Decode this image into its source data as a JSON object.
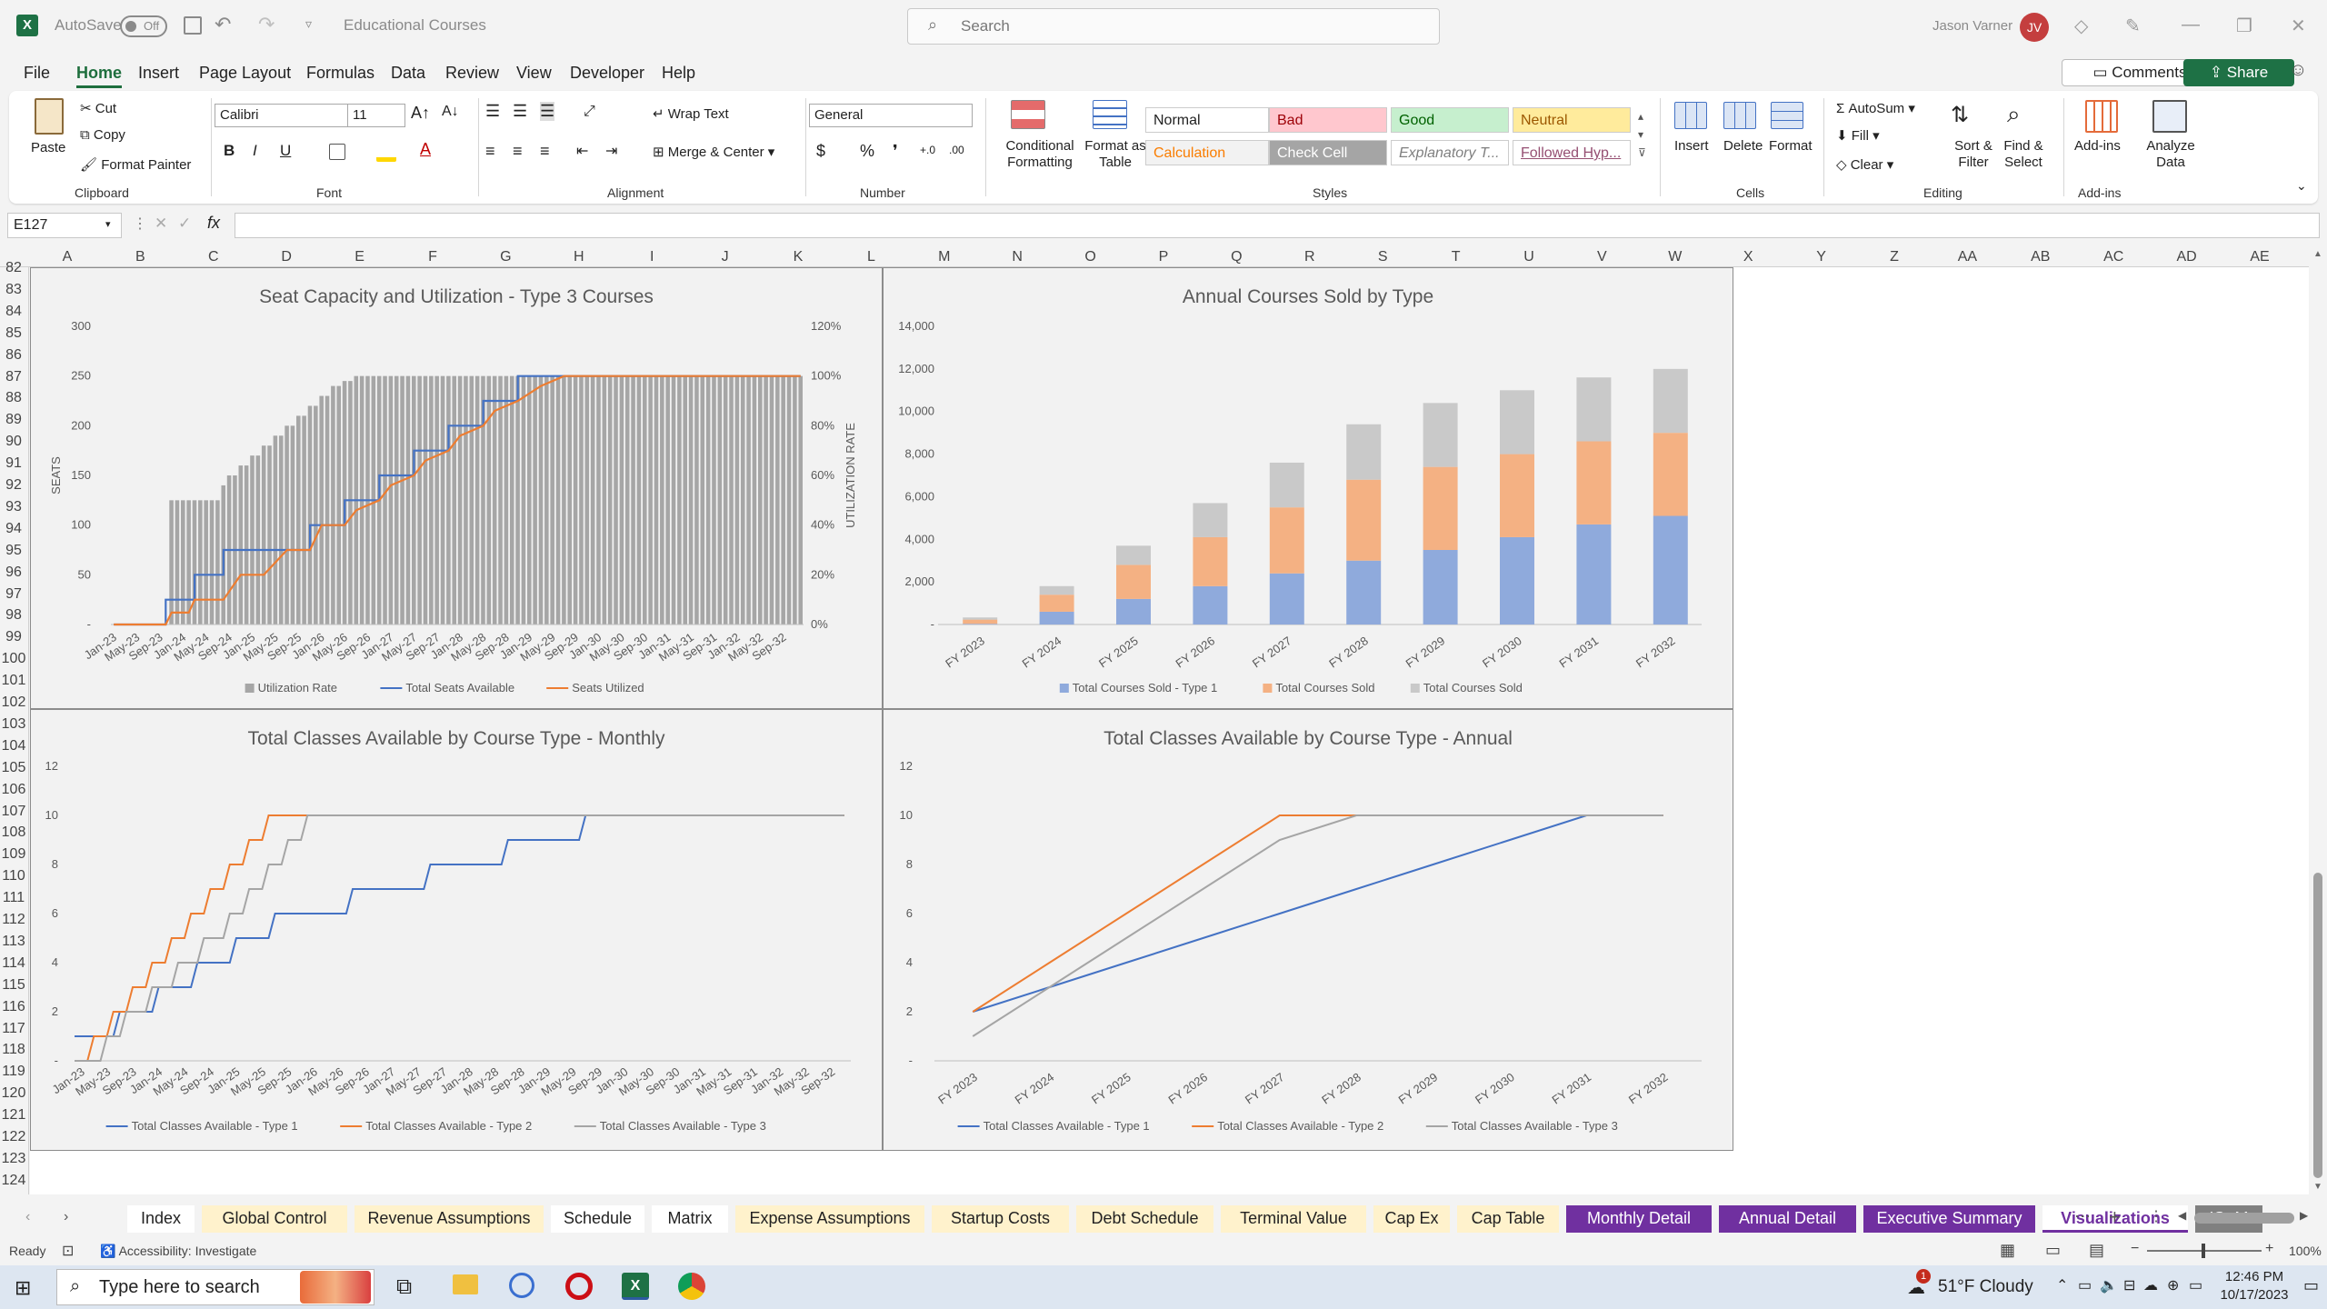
{
  "titlebar": {
    "autosave": "AutoSave",
    "autosave_state": "Off",
    "filename": "Educational Courses",
    "search_placeholder": "Search",
    "user": "Jason Varner",
    "initials": "JV"
  },
  "menu": [
    "File",
    "Home",
    "Insert",
    "Page Layout",
    "Formulas",
    "Data",
    "Review",
    "View",
    "Developer",
    "Help"
  ],
  "menu_active": "Home",
  "actions": {
    "comments": "Comments",
    "share": "Share"
  },
  "ribbon": {
    "clipboard": {
      "paste": "Paste",
      "cut": "Cut",
      "copy": "Copy",
      "format_painter": "Format Painter",
      "label": "Clipboard"
    },
    "font": {
      "name": "Calibri",
      "size": "11",
      "label": "Font",
      "bold": "B",
      "italic": "I",
      "underline": "U"
    },
    "alignment": {
      "wrap": "Wrap Text",
      "merge": "Merge & Center",
      "label": "Alignment"
    },
    "number": {
      "format": "General",
      "label": "Number",
      "currency": "$",
      "percent": "%"
    },
    "styles": {
      "conditional": "Conditional Formatting",
      "format_table": "Format as Table",
      "label": "Styles",
      "cells": [
        {
          "name": "Normal",
          "bg": "#ffffff",
          "fg": "#222222"
        },
        {
          "name": "Bad",
          "bg": "#ffc7ce",
          "fg": "#9c0006"
        },
        {
          "name": "Good",
          "bg": "#c6efce",
          "fg": "#006100"
        },
        {
          "name": "Neutral",
          "bg": "#ffeb9c",
          "fg": "#9c5700"
        },
        {
          "name": "Calculation",
          "bg": "#f2f2f2",
          "fg": "#fa7d00"
        },
        {
          "name": "Check Cell",
          "bg": "#a5a5a5",
          "fg": "#ffffff"
        },
        {
          "name": "Explanatory T...",
          "bg": "#ffffff",
          "fg": "#7f7f7f"
        },
        {
          "name": "Followed Hyp...",
          "bg": "#ffffff",
          "fg": "#954f72"
        }
      ]
    },
    "cells": {
      "insert": "Insert",
      "delete": "Delete",
      "format": "Format",
      "label": "Cells"
    },
    "editing": {
      "autosum": "AutoSum",
      "fill": "Fill",
      "clear": "Clear",
      "sort": "Sort & Filter",
      "find": "Find & Select",
      "label": "Editing"
    },
    "addins": {
      "addins": "Add-ins",
      "analyze": "Analyze Data",
      "label": "Add-ins"
    }
  },
  "formula": {
    "namebox": "E127",
    "fx": "fx",
    "value": ""
  },
  "columns": [
    "A",
    "B",
    "C",
    "D",
    "E",
    "F",
    "G",
    "H",
    "I",
    "J",
    "K",
    "L",
    "M",
    "N",
    "O",
    "P",
    "Q",
    "R",
    "S",
    "T",
    "U",
    "V",
    "W",
    "X",
    "Y",
    "Z",
    "AA",
    "AB",
    "AC",
    "AD",
    "AE"
  ],
  "rows": [
    "82",
    "83",
    "84",
    "85",
    "86",
    "87",
    "88",
    "89",
    "90",
    "91",
    "92",
    "93",
    "94",
    "95",
    "96",
    "97",
    "98",
    "99",
    "100",
    "101",
    "102",
    "103",
    "104",
    "105",
    "106",
    "107",
    "108",
    "109",
    "110",
    "111",
    "112",
    "113",
    "114",
    "115",
    "116",
    "117",
    "118",
    "119",
    "120",
    "121",
    "122",
    "123",
    "124"
  ],
  "chart_data": [
    {
      "type": "bar",
      "title": "Seat Capacity and Utilization - Type 3 Courses",
      "ylabel": "SEATS",
      "y2label": "UTILIZATION RATE",
      "ylim": [
        0,
        300
      ],
      "y2lim": [
        0,
        1.2
      ],
      "yticks": [
        "300",
        "250",
        "200",
        "150",
        "100",
        "50",
        "-"
      ],
      "y2ticks": [
        "120%",
        "100%",
        "80%",
        "60%",
        "40%",
        "20%",
        "0%"
      ],
      "xticks": [
        "Jan-23",
        "May-23",
        "Sep-23",
        "Jan-24",
        "May-24",
        "Sep-24",
        "Jan-25",
        "May-25",
        "Sep-25",
        "Jan-26",
        "May-26",
        "Sep-26",
        "Jan-27",
        "May-27",
        "Sep-27",
        "Jan-28",
        "May-28",
        "Sep-28",
        "Jan-29",
        "May-29",
        "Sep-29",
        "Jan-30",
        "May-30",
        "Sep-30",
        "Jan-31",
        "May-31",
        "Sep-31",
        "Jan-32",
        "May-32",
        "Sep-32"
      ],
      "series": [
        {
          "name": "Utilization Rate",
          "kind": "bar",
          "color": "#a6a6a6",
          "step_points": [
            [
              0,
              0
            ],
            [
              9,
              0
            ],
            [
              10,
              0.5
            ],
            [
              18,
              0.5
            ],
            [
              19,
              0.56
            ],
            [
              20,
              0.6
            ],
            [
              22,
              0.64
            ],
            [
              24,
              0.68
            ],
            [
              26,
              0.72
            ],
            [
              28,
              0.76
            ],
            [
              30,
              0.8
            ],
            [
              32,
              0.84
            ],
            [
              34,
              0.88
            ],
            [
              36,
              0.92
            ],
            [
              38,
              0.96
            ],
            [
              40,
              0.98
            ],
            [
              42,
              1.0
            ],
            [
              119,
              1.0
            ]
          ]
        },
        {
          "name": "Total Seats Available",
          "kind": "line",
          "color": "#4472c4",
          "step_points": [
            [
              0,
              0
            ],
            [
              9,
              0
            ],
            [
              9,
              25
            ],
            [
              14,
              25
            ],
            [
              14,
              50
            ],
            [
              19,
              50
            ],
            [
              19,
              75
            ],
            [
              34,
              75
            ],
            [
              34,
              100
            ],
            [
              40,
              100
            ],
            [
              40,
              125
            ],
            [
              46,
              125
            ],
            [
              46,
              150
            ],
            [
              52,
              150
            ],
            [
              52,
              175
            ],
            [
              58,
              175
            ],
            [
              58,
              200
            ],
            [
              64,
              200
            ],
            [
              64,
              225
            ],
            [
              70,
              225
            ],
            [
              70,
              250
            ],
            [
              119,
              250
            ]
          ]
        },
        {
          "name": "Seats Utilized",
          "kind": "line",
          "color": "#ed7d31",
          "points": [
            [
              0,
              0
            ],
            [
              9,
              0
            ],
            [
              10,
              12
            ],
            [
              13,
              12
            ],
            [
              14,
              25
            ],
            [
              19,
              25
            ],
            [
              22,
              50
            ],
            [
              26,
              50
            ],
            [
              30,
              75
            ],
            [
              34,
              75
            ],
            [
              36,
              100
            ],
            [
              40,
              100
            ],
            [
              42,
              115
            ],
            [
              46,
              125
            ],
            [
              48,
              140
            ],
            [
              52,
              150
            ],
            [
              54,
              165
            ],
            [
              58,
              175
            ],
            [
              60,
              190
            ],
            [
              64,
              200
            ],
            [
              66,
              215
            ],
            [
              70,
              225
            ],
            [
              74,
              240
            ],
            [
              78,
              250
            ],
            [
              119,
              250
            ]
          ]
        }
      ],
      "x_count": 120,
      "legend": "bottom"
    },
    {
      "type": "bar",
      "title": "Annual Courses Sold by Type",
      "categories": [
        "FY 2023",
        "FY 2024",
        "FY 2025",
        "FY 2026",
        "FY 2027",
        "FY 2028",
        "FY 2029",
        "FY 2030",
        "FY 2031",
        "FY 2032"
      ],
      "ylim": [
        0,
        14000
      ],
      "yticks": [
        "14,000",
        "12,000",
        "10,000",
        "8,000",
        "6,000",
        "4,000",
        "2,000",
        "-"
      ],
      "series": [
        {
          "name": "Total Courses Sold - Type 1",
          "color": "#8faadc",
          "values": [
            30,
            600,
            1200,
            1800,
            2400,
            3000,
            3500,
            4100,
            4700,
            5100
          ]
        },
        {
          "name": "Total Courses Sold",
          "color": "#f4b183",
          "values": [
            200,
            800,
            1600,
            2300,
            3100,
            3800,
            3900,
            3900,
            3900,
            3900
          ]
        },
        {
          "name": "Total Courses Sold",
          "color": "#c9c9c9",
          "values": [
            100,
            400,
            900,
            1600,
            2100,
            2600,
            3000,
            3000,
            3000,
            3000
          ]
        }
      ],
      "legend": "bottom"
    },
    {
      "type": "line",
      "title": "Total Classes Available by Course Type - Monthly",
      "ylim": [
        0,
        12
      ],
      "yticks": [
        "12",
        "10",
        "8",
        "6",
        "4",
        "2",
        "-"
      ],
      "xticks": [
        "Jan-23",
        "May-23",
        "Sep-23",
        "Jan-24",
        "May-24",
        "Sep-24",
        "Jan-25",
        "May-25",
        "Sep-25",
        "Jan-26",
        "May-26",
        "Sep-26",
        "Jan-27",
        "May-27",
        "Sep-27",
        "Jan-28",
        "May-28",
        "Sep-28",
        "Jan-29",
        "May-29",
        "Sep-29",
        "Jan-30",
        "May-30",
        "Sep-30",
        "Jan-31",
        "May-31",
        "Sep-31",
        "Jan-32",
        "May-32",
        "Sep-32"
      ],
      "x_count": 120,
      "series": [
        {
          "name": "Total Classes Available - Type 1",
          "color": "#4472c4",
          "points": [
            [
              0,
              1
            ],
            [
              6,
              1
            ],
            [
              7,
              2
            ],
            [
              12,
              2
            ],
            [
              13,
              3
            ],
            [
              18,
              3
            ],
            [
              19,
              4
            ],
            [
              24,
              4
            ],
            [
              25,
              5
            ],
            [
              30,
              5
            ],
            [
              31,
              6
            ],
            [
              42,
              6
            ],
            [
              43,
              7
            ],
            [
              54,
              7
            ],
            [
              55,
              8
            ],
            [
              66,
              8
            ],
            [
              67,
              9
            ],
            [
              78,
              9
            ],
            [
              79,
              10
            ],
            [
              119,
              10
            ]
          ]
        },
        {
          "name": "Total Classes Available - Type 2",
          "color": "#ed7d31",
          "points": [
            [
              0,
              0
            ],
            [
              2,
              0
            ],
            [
              3,
              1
            ],
            [
              5,
              1
            ],
            [
              6,
              2
            ],
            [
              8,
              2
            ],
            [
              9,
              3
            ],
            [
              11,
              3
            ],
            [
              12,
              4
            ],
            [
              14,
              4
            ],
            [
              15,
              5
            ],
            [
              17,
              5
            ],
            [
              18,
              6
            ],
            [
              20,
              6
            ],
            [
              21,
              7
            ],
            [
              23,
              7
            ],
            [
              24,
              8
            ],
            [
              26,
              8
            ],
            [
              27,
              9
            ],
            [
              29,
              9
            ],
            [
              30,
              10
            ],
            [
              119,
              10
            ]
          ]
        },
        {
          "name": "Total Classes Available - Type 3",
          "color": "#a5a5a5",
          "points": [
            [
              0,
              0
            ],
            [
              4,
              0
            ],
            [
              5,
              1
            ],
            [
              7,
              1
            ],
            [
              8,
              2
            ],
            [
              11,
              2
            ],
            [
              12,
              3
            ],
            [
              15,
              3
            ],
            [
              16,
              4
            ],
            [
              19,
              4
            ],
            [
              20,
              5
            ],
            [
              23,
              5
            ],
            [
              24,
              6
            ],
            [
              26,
              6
            ],
            [
              27,
              7
            ],
            [
              29,
              7
            ],
            [
              30,
              8
            ],
            [
              32,
              8
            ],
            [
              33,
              9
            ],
            [
              35,
              9
            ],
            [
              36,
              10
            ],
            [
              119,
              10
            ]
          ]
        }
      ],
      "legend": "bottom"
    },
    {
      "type": "line",
      "title": "Total Classes Available by Course Type - Annual",
      "ylim": [
        0,
        12
      ],
      "yticks": [
        "12",
        "10",
        "8",
        "6",
        "4",
        "2",
        "-"
      ],
      "categories": [
        "FY 2023",
        "FY 2024",
        "FY 2025",
        "FY 2026",
        "FY 2027",
        "FY 2028",
        "FY 2029",
        "FY 2030",
        "FY 2031",
        "FY 2032"
      ],
      "series": [
        {
          "name": "Total Classes Available - Type 1",
          "color": "#4472c4",
          "values": [
            2,
            3,
            4,
            5,
            6,
            7,
            8,
            9,
            10,
            10
          ]
        },
        {
          "name": "Total Classes Available - Type 2",
          "color": "#ed7d31",
          "values": [
            2,
            4,
            6,
            8,
            10,
            10,
            10,
            10,
            10,
            10
          ]
        },
        {
          "name": "Total Classes Available - Type 3",
          "color": "#a5a5a5",
          "values": [
            1,
            3,
            5,
            7,
            9,
            10,
            10,
            10,
            10,
            10
          ]
        }
      ],
      "legend": "bottom"
    }
  ],
  "tabs": [
    {
      "label": "Index",
      "style": "plain"
    },
    {
      "label": "Global Control",
      "style": "yellow"
    },
    {
      "label": "Revenue Assumptions",
      "style": "yellow"
    },
    {
      "label": "Schedule",
      "style": "plain"
    },
    {
      "label": "Matrix",
      "style": "plain"
    },
    {
      "label": "Expense Assumptions",
      "style": "yellow"
    },
    {
      "label": "Startup Costs",
      "style": "yellow"
    },
    {
      "label": "Debt Schedule",
      "style": "yellow"
    },
    {
      "label": "Terminal Value",
      "style": "yellow"
    },
    {
      "label": "Cap Ex",
      "style": "yellow"
    },
    {
      "label": "Cap Table",
      "style": "yellow"
    },
    {
      "label": "Monthly Detail",
      "style": "purple"
    },
    {
      "label": "Annual Detail",
      "style": "purple"
    },
    {
      "label": "Executive Summary",
      "style": "purple"
    },
    {
      "label": "Visualizations",
      "style": "active"
    },
    {
      "label": "IS- M",
      "style": "gray"
    }
  ],
  "status": {
    "ready": "Ready",
    "accessibility": "Accessibility: Investigate",
    "zoom": "100%"
  },
  "taskbar": {
    "search": "Type here to search",
    "weather": "51°F  Cloudy",
    "time": "12:46 PM",
    "date": "10/17/2023",
    "badge": "1"
  }
}
